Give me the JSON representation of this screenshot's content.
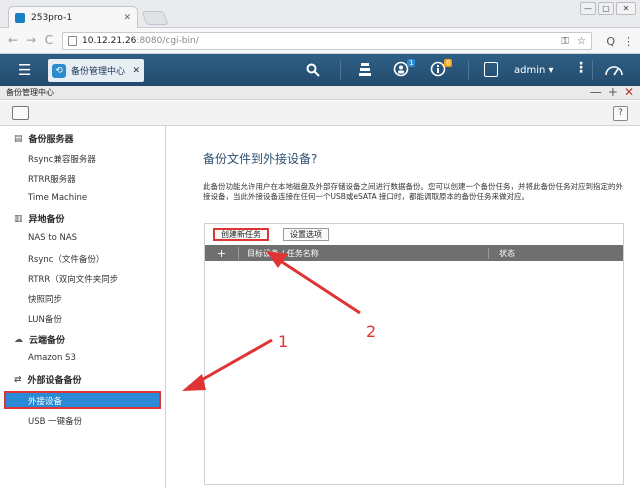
{
  "browser": {
    "tab_title": "253pro-1",
    "tab_close": "✕",
    "url_host": "10.12.21.26",
    "url_path": ":8080/cgi-bin/",
    "nav": {
      "back": "←",
      "forward": "→",
      "reload": "C"
    },
    "omni_icons": [
      "⚿",
      "☆"
    ],
    "ext_icons": [
      "Q",
      "⋮"
    ],
    "window_buttons": [
      "—",
      "▢",
      "✕"
    ]
  },
  "nas_header": {
    "app_tab_label": "备份管理中心",
    "app_tab_close": "✕",
    "notify_badge": "1",
    "info_badge": "6",
    "username": "admin ▾"
  },
  "app_window": {
    "title": "备份管理中心",
    "controls": [
      "—",
      "+",
      "✕"
    ],
    "help": "?"
  },
  "sidebar": {
    "groups": [
      {
        "label": "备份服务器",
        "icon": "server-icon",
        "glyph": "▤",
        "items": [
          "Rsync兼容服务器",
          "RTRR服务器",
          "Time Machine"
        ]
      },
      {
        "label": "异地备份",
        "icon": "remote-backup-icon",
        "glyph": "▥",
        "items": [
          "NAS to NAS",
          "Rsync（文件备份）",
          "RTRR（双向文件夹同步",
          "快照同步",
          "LUN备份"
        ]
      },
      {
        "label": "云端备份",
        "icon": "cloud-icon",
        "glyph": "☁",
        "items": [
          "Amazon S3"
        ]
      },
      {
        "label": "外部设备备份",
        "icon": "sync-icon",
        "glyph": "⇄",
        "items": [
          "外接设备",
          "USB 一键备份"
        ]
      }
    ]
  },
  "main": {
    "title": "备份文件到外接设备?",
    "description": "此备份功能允许用户在本地磁盘及外部存储设备之间进行数据备份。您可以创建一个备份任务，并将此备份任务对应到指定的外接设备，当此外接设备连接在任何一个USB或eSATA 接口时，都能调取原本的备份任务来做对应。",
    "create_button": "创建新任务",
    "settings_button": "设置选项",
    "columns": {
      "add": "+",
      "target": "目标设备 / 任务名称",
      "status": "状态"
    }
  },
  "annotations": {
    "arrow_1": "1",
    "arrow_2": "2"
  },
  "colors": {
    "header_blue": "#2f5f86",
    "selection_blue": "#2a8ad6",
    "annotation_red": "#e03434"
  }
}
